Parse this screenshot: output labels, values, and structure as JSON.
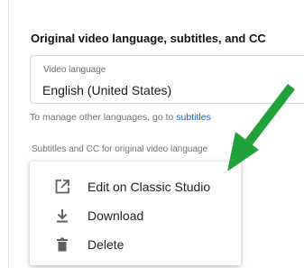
{
  "section": {
    "title": "Original video language, subtitles, and CC"
  },
  "language_field": {
    "label": "Video language",
    "value": "English (United States)"
  },
  "helper": {
    "prefix": "To manage other languages, go to ",
    "link_text": "subtitles"
  },
  "subtitles_label": "Subtitles and CC for original video language",
  "menu": {
    "items": [
      {
        "label": "Edit on Classic Studio",
        "icon": "open-in-new-icon"
      },
      {
        "label": "Download",
        "icon": "download-icon"
      },
      {
        "label": "Delete",
        "icon": "delete-icon"
      }
    ]
  },
  "colors": {
    "accent_arrow": "#1fa23a",
    "link": "#1a5fc4",
    "icon": "#5f5f5f"
  }
}
